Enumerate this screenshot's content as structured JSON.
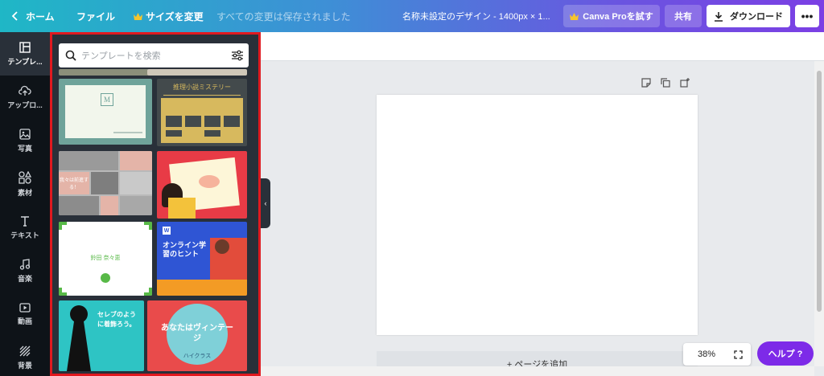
{
  "topbar": {
    "back_label": "ホーム",
    "file_label": "ファイル",
    "resize_label": "サイズを変更",
    "save_status": "すべての変更は保存されました",
    "design_title": "名称未設定のデザイン - 1400px × 1...",
    "pro_label": "Canva Proを試す",
    "share_label": "共有",
    "download_label": "ダウンロード",
    "more_label": "•••"
  },
  "sidebar": {
    "items": [
      {
        "label": "テンプレ...",
        "icon": "layout-icon"
      },
      {
        "label": "アップロ...",
        "icon": "upload-cloud-icon"
      },
      {
        "label": "写真",
        "icon": "photo-icon"
      },
      {
        "label": "素材",
        "icon": "shapes-icon"
      },
      {
        "label": "テキスト",
        "icon": "text-icon"
      },
      {
        "label": "音楽",
        "icon": "music-icon"
      },
      {
        "label": "動画",
        "icon": "video-icon"
      },
      {
        "label": "背景",
        "icon": "background-icon"
      }
    ]
  },
  "panel": {
    "search_placeholder": "テンプレートを検索",
    "templates": [
      {
        "name": "template-monogram-card",
        "letter": "M"
      },
      {
        "name": "template-mystery-club",
        "title": "推理小説ミステリー"
      },
      {
        "name": "template-photo-collage",
        "title": "我々は前進する！"
      },
      {
        "name": "template-child-drawing"
      },
      {
        "name": "template-certificate",
        "name_text": "鈴田 奈々恵"
      },
      {
        "name": "template-online-learning",
        "title": "オンライン学習のヒント",
        "badge": "W"
      },
      {
        "name": "template-celebrity",
        "title": "セレブのように着飾ろう。"
      },
      {
        "name": "template-vintage",
        "title": "あなたはヴィンテージ",
        "sub": "ハイクラス"
      }
    ]
  },
  "editor": {
    "add_page_label": "+ ページを追加",
    "zoom_value": "38%",
    "help_label": "ヘルプ ?"
  },
  "colors": {
    "brand_gradient_start": "#1fb7c6",
    "brand_gradient_end": "#7b3fe4",
    "panel_bg": "#293039",
    "highlight_border": "#e0191f",
    "help_purple": "#7d2ae8"
  }
}
